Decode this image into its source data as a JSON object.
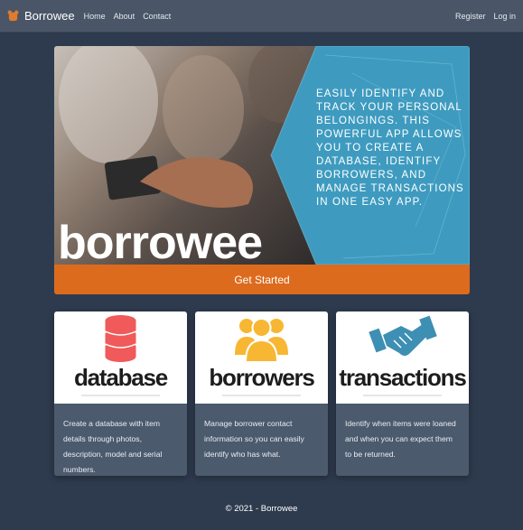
{
  "navbar": {
    "brand": "Borrowee",
    "links": [
      "Home",
      "About",
      "Contact"
    ],
    "right_links": [
      "Register",
      "Log in"
    ]
  },
  "hero": {
    "text": "Easily identify and track your personal belongings. This powerful app allows you to create a database, identify borrowers, and manage transactions in one easy app.",
    "logo": "borrowee",
    "cta_label": "Get Started"
  },
  "cards": [
    {
      "title": "database",
      "icon": "database-icon",
      "body": "Create a database with item details through photos, description, model and serial numbers."
    },
    {
      "title": "borrowers",
      "icon": "users-icon",
      "body": "Manage borrower contact information so you can easily identify who has what."
    },
    {
      "title": "transactions",
      "icon": "handshake-icon",
      "body": "Identify when items were loaned and when you can expect them to be returned."
    }
  ],
  "footer": {
    "text": "© 2021 - Borrowee"
  },
  "colors": {
    "background": "#2e3b4e",
    "navbar": "#4a5668",
    "cta": "#dd6b1e",
    "hero_panel": "#3e9bbf",
    "database_icon": "#f05a5a",
    "borrowers_icon": "#f7b733",
    "transactions_icon": "#3d8fb3"
  }
}
